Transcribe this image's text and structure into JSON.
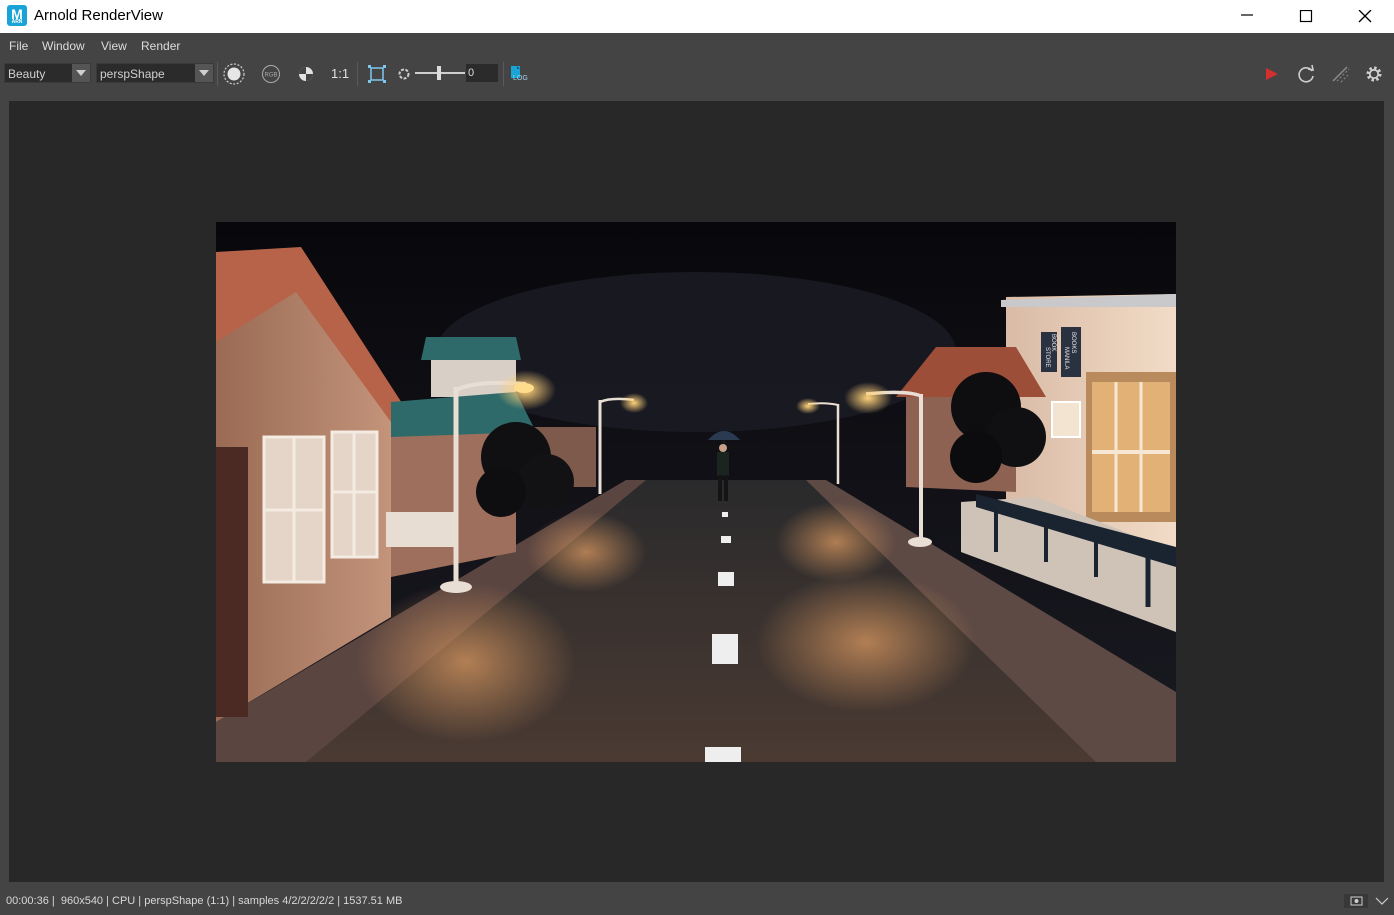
{
  "window": {
    "title": "Arnold RenderView",
    "app_icon_letter": "M",
    "app_icon_sub": "ARN"
  },
  "menu": {
    "items": [
      "File",
      "Window",
      "View",
      "Render"
    ]
  },
  "toolbar": {
    "aov_select": "Beauty",
    "camera_select": "perspShape",
    "rgb_label": "RGB",
    "ratio_label": "1:1",
    "exposure_value": "0",
    "log_label": "LOG",
    "colors": {
      "render_button": "#d22f2f",
      "accent": "#1aa3d6"
    }
  },
  "render": {
    "scene": "night street with houses, street lamps, BOOKS MANILA book store sign and figure with umbrella",
    "sign_text": [
      "BOOK",
      "STORE",
      "BOOKS",
      "MANILA"
    ]
  },
  "status": {
    "text": "00:00:36 |  960x540 | CPU | perspShape (1:1) | samples 4/2/2/2/2/2 | 1537.51 MB"
  }
}
